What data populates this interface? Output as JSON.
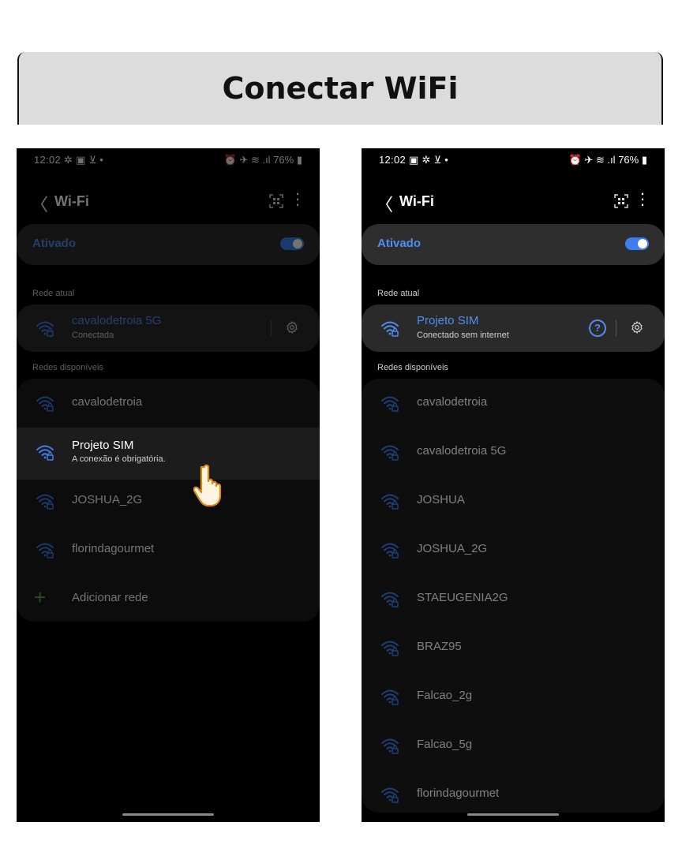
{
  "banner": {
    "title": "Conectar WiFi"
  },
  "left": {
    "status": {
      "time": "12:02",
      "icons": "✲ ▣ ⊻ •",
      "battery": "76%"
    },
    "title": "Wi-Fi",
    "toggle_label": "Ativado",
    "toggle_on": true,
    "current_section": "Rede atual",
    "current": {
      "name": "cavalodetroia 5G",
      "status": "Conectada"
    },
    "available_section": "Redes disponíveis",
    "networks": [
      {
        "name": "cavalodetroia"
      },
      {
        "name": "Projeto SIM",
        "sub": "A conexão é obrigatória."
      },
      {
        "name": "JOSHUA_2G"
      },
      {
        "name": "florindagourmet"
      }
    ],
    "add_network": "Adicionar rede"
  },
  "right": {
    "status": {
      "time": "12:02",
      "icons": "▣ ✲ ⊻ •",
      "battery": "76%"
    },
    "title": "Wi-Fi",
    "toggle_label": "Ativado",
    "toggle_on": true,
    "current_section": "Rede atual",
    "current": {
      "name": "Projeto SIM",
      "status": "Conectado sem internet"
    },
    "available_section": "Redes disponíveis",
    "networks": [
      {
        "name": "cavalodetroia"
      },
      {
        "name": "cavalodetroia 5G"
      },
      {
        "name": "JOSHUA"
      },
      {
        "name": "JOSHUA_2G"
      },
      {
        "name": "STAEUGENIA2G"
      },
      {
        "name": "BRAZ95"
      },
      {
        "name": "Falcao_2g"
      },
      {
        "name": "Falcao_5g"
      },
      {
        "name": "florindagourmet"
      }
    ]
  },
  "colors": {
    "accent": "#4f8ef0",
    "wifi_blue": "#3f7ef0",
    "add_green": "#4caf50"
  },
  "icons": [
    "chevron-left-icon",
    "qr-scan-icon",
    "more-vert-icon",
    "wifi-lock-icon",
    "gear-icon",
    "help-icon",
    "plus-icon",
    "hand-pointer-icon"
  ]
}
